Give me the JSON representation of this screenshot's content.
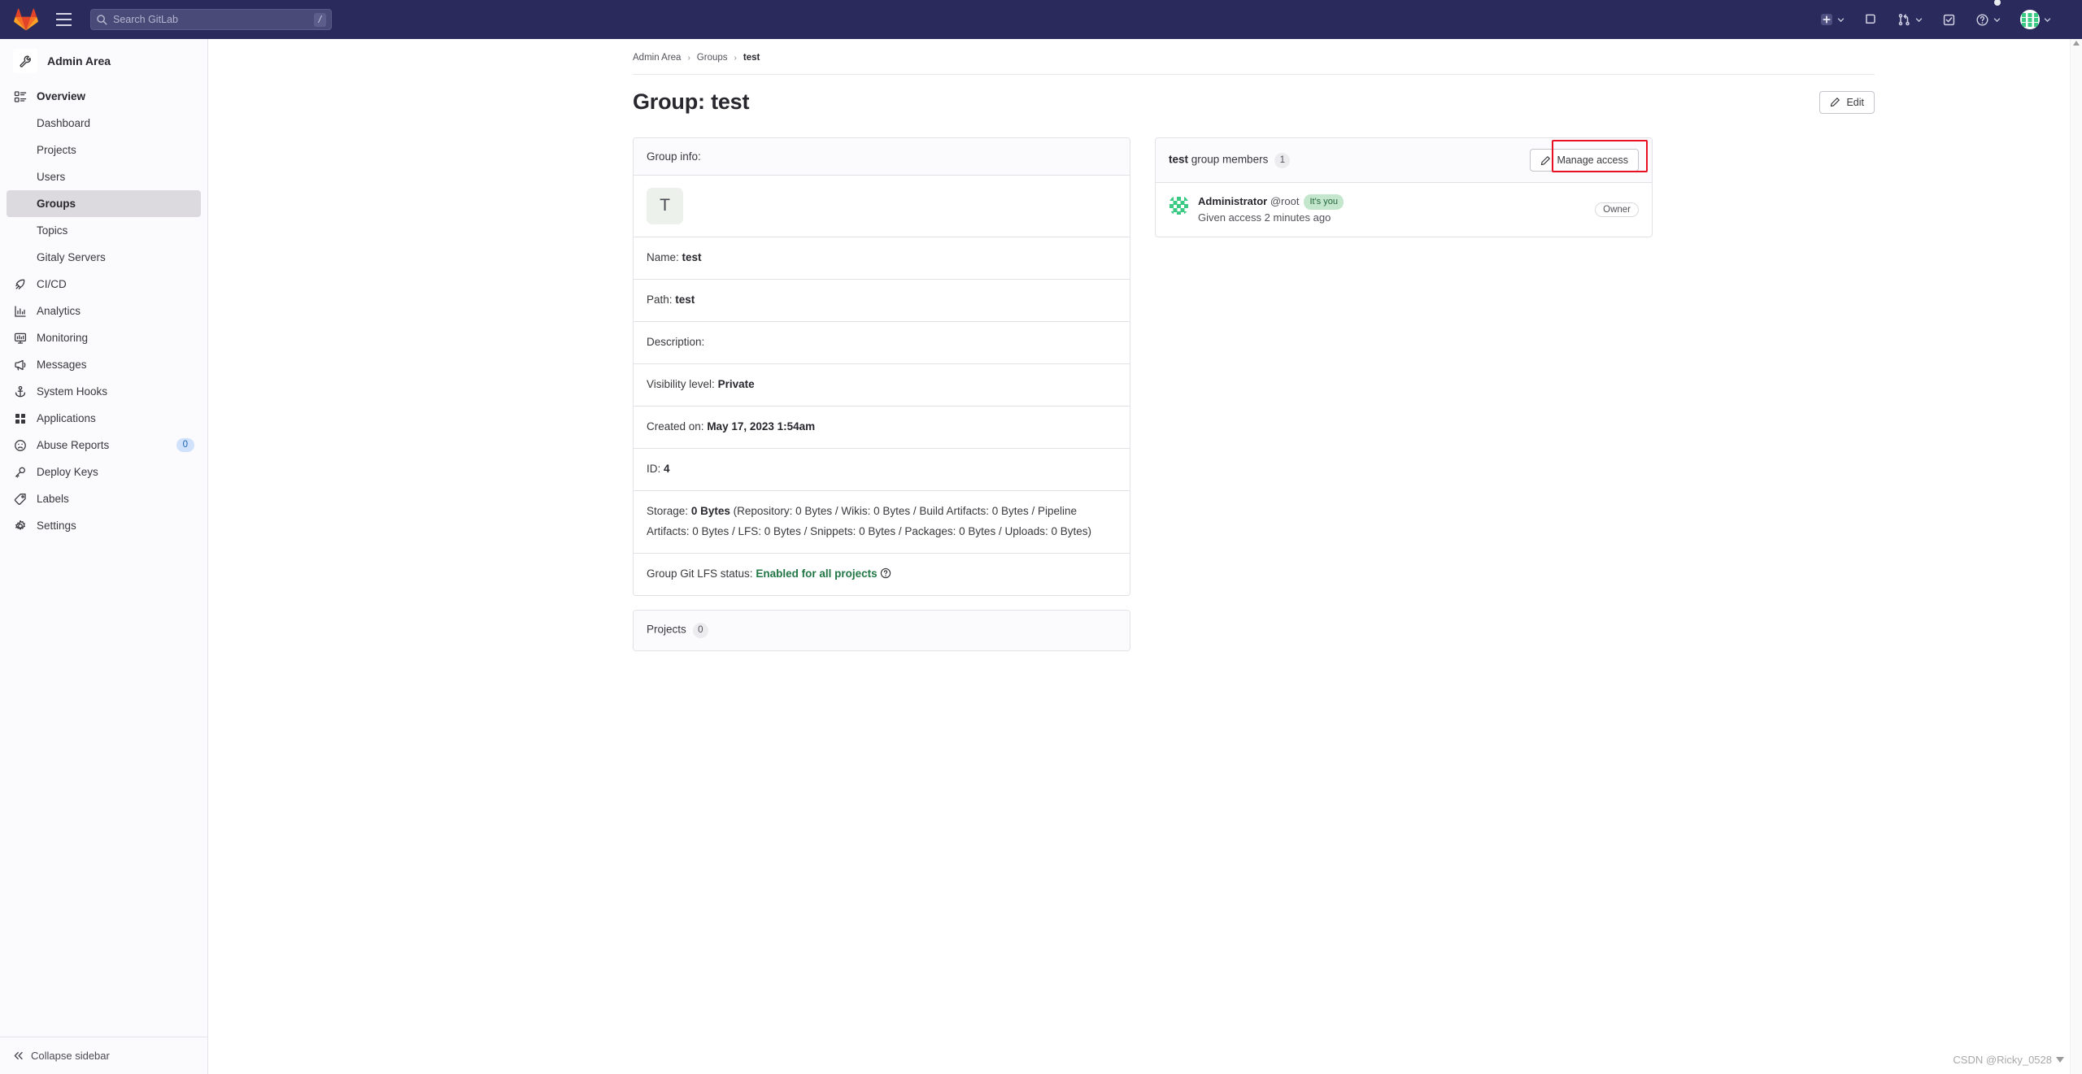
{
  "topbar": {
    "logo_icon": "gitlab-logo-icon",
    "hamburger_icon": "hamburger-menu-icon",
    "search": {
      "icon": "search-icon",
      "placeholder": "Search GitLab",
      "value": "",
      "shortcut_key": "/"
    },
    "actions": [
      {
        "icon": "plus-square-icon",
        "label": "",
        "has_caret": true
      },
      {
        "icon": "issues-icon",
        "label": "",
        "has_caret": false
      },
      {
        "icon": "merge-requests-icon",
        "label": "",
        "has_caret": true
      },
      {
        "icon": "todos-checkbox-icon",
        "label": "",
        "has_caret": false
      },
      {
        "icon": "help-question-icon",
        "label": "",
        "has_caret": true,
        "has_dot": true
      },
      {
        "icon": "user-avatar-icon",
        "label": "",
        "has_caret": true
      }
    ]
  },
  "sidebar": {
    "header": {
      "label": "Admin Area",
      "icon": "wrench-icon"
    },
    "items": [
      {
        "label": "Overview",
        "icon": "overview-grid-icon",
        "type": "top",
        "name": "overview"
      },
      {
        "label": "Dashboard",
        "type": "sub",
        "name": "dashboard",
        "active": false
      },
      {
        "label": "Projects",
        "type": "sub",
        "name": "projects",
        "active": false
      },
      {
        "label": "Users",
        "type": "sub",
        "name": "users",
        "active": false
      },
      {
        "label": "Groups",
        "type": "sub",
        "name": "groups",
        "active": true
      },
      {
        "label": "Topics",
        "type": "sub",
        "name": "topics",
        "active": false
      },
      {
        "label": "Gitaly Servers",
        "type": "sub",
        "name": "gitaly-servers",
        "active": false
      },
      {
        "label": "CI/CD",
        "icon": "rocket-icon",
        "type": "top-plain",
        "name": "ci-cd"
      },
      {
        "label": "Analytics",
        "icon": "analytics-bar-icon",
        "type": "top-plain",
        "name": "analytics"
      },
      {
        "label": "Monitoring",
        "icon": "monitor-icon",
        "type": "top-plain",
        "name": "monitoring"
      },
      {
        "label": "Messages",
        "icon": "megaphone-icon",
        "type": "top-plain",
        "name": "messages"
      },
      {
        "label": "System Hooks",
        "icon": "anchor-icon",
        "type": "top-plain",
        "name": "system-hooks"
      },
      {
        "label": "Applications",
        "icon": "apps-grid-icon",
        "type": "top-plain",
        "name": "applications"
      },
      {
        "label": "Abuse Reports",
        "icon": "frown-face-icon",
        "type": "top-plain",
        "name": "abuse-reports",
        "badge": "0"
      },
      {
        "label": "Deploy Keys",
        "icon": "key-icon",
        "type": "top-plain",
        "name": "deploy-keys"
      },
      {
        "label": "Labels",
        "icon": "label-tag-icon",
        "type": "top-plain",
        "name": "labels"
      },
      {
        "label": "Settings",
        "icon": "gear-icon",
        "type": "top-plain",
        "name": "settings"
      }
    ],
    "collapse": {
      "label": "Collapse sidebar",
      "icon": "chevron-double-left-icon"
    }
  },
  "breadcrumb": {
    "items": [
      "Admin Area",
      "Groups",
      "test"
    ],
    "separator": "›"
  },
  "header": {
    "title": "Group: test",
    "edit_button": {
      "label": "Edit",
      "icon": "pencil-icon"
    }
  },
  "group_info": {
    "card_title": "Group info:",
    "avatar_letter": "T",
    "avatar_bg": "#ecf1ec",
    "rows": [
      {
        "label": "Name:",
        "value": "test"
      },
      {
        "label": "Path:",
        "value": "test"
      },
      {
        "label": "Description:",
        "value": ""
      },
      {
        "label": "Visibility level:",
        "value": "Private"
      },
      {
        "label": "Created on:",
        "value": "May 17, 2023 1:54am"
      },
      {
        "label": "ID:",
        "value": "4"
      }
    ],
    "storage": {
      "label": "Storage:",
      "total": "0 Bytes",
      "detail": "(Repository: 0 Bytes / Wikis: 0 Bytes / Build Artifacts: 0 Bytes / Pipeline Artifacts: 0 Bytes / LFS: 0 Bytes / Snippets: 0 Bytes / Packages: 0 Bytes / Uploads: 0 Bytes)"
    },
    "lfs": {
      "label": "Group Git LFS status:",
      "value": "Enabled for all projects",
      "help_icon": "question-circle-icon",
      "value_color": "#217645"
    }
  },
  "projects_card": {
    "label": "Projects",
    "count": "0"
  },
  "members": {
    "title_bold": "test",
    "title_rest": "group members",
    "count": "1",
    "manage_button": {
      "label": "Manage access",
      "icon": "pencil-icon"
    },
    "highlight_color": "#e81123",
    "list": [
      {
        "name": "Administrator",
        "handle": "@root",
        "badge": "It's you",
        "meta": "Given access 2 minutes ago",
        "role": "Owner",
        "avatar_icon": "identicon-avatar"
      }
    ]
  },
  "watermark": {
    "text": "CSDN @Ricky_0528"
  }
}
